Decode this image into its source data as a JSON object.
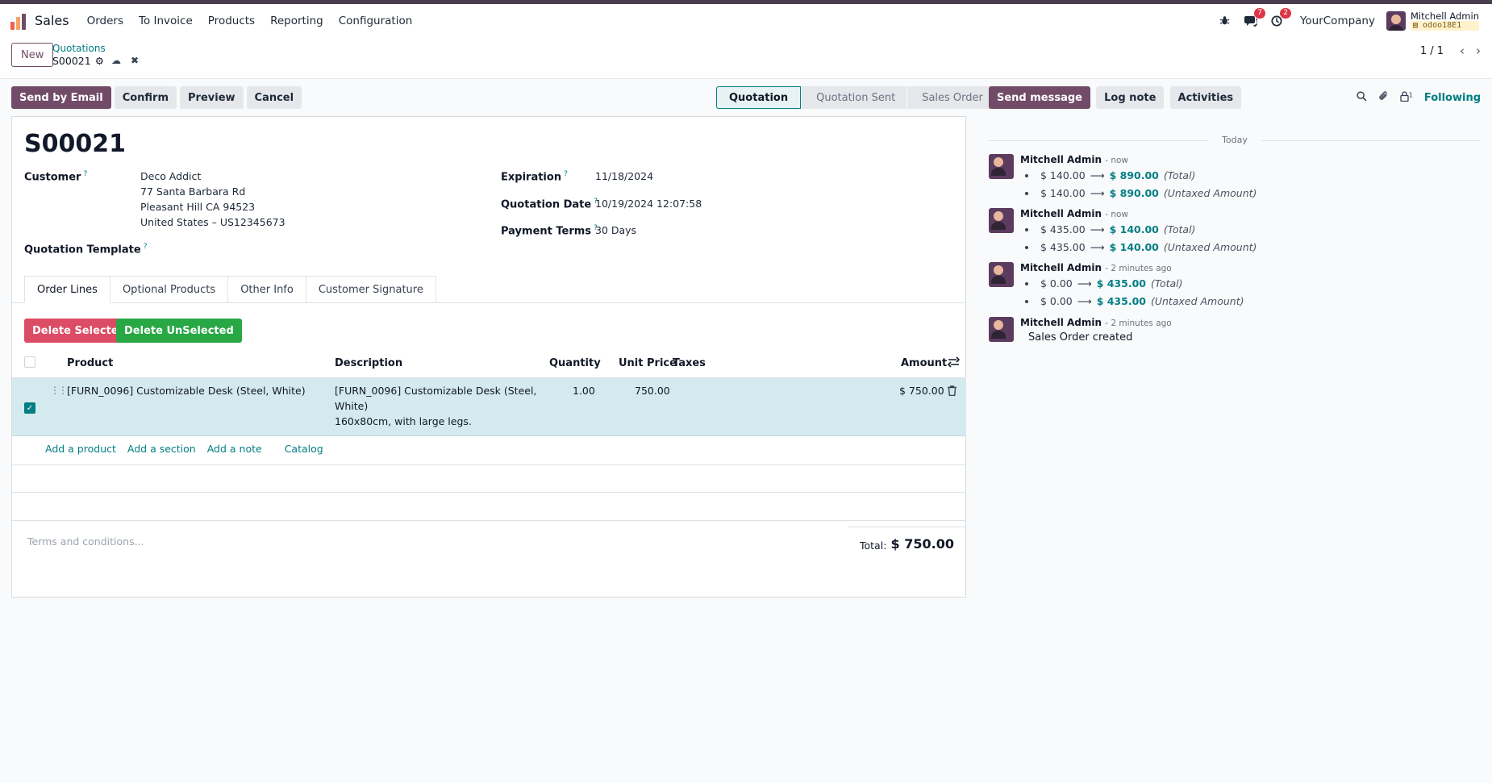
{
  "navbar": {
    "app_name": "Sales",
    "menu": [
      "Orders",
      "To Invoice",
      "Products",
      "Reporting",
      "Configuration"
    ],
    "messages_badge": "7",
    "activities_badge": "2",
    "company": "YourCompany",
    "user_name": "Mitchell Admin",
    "db_name": "odoo18E1"
  },
  "control": {
    "new_label": "New",
    "breadcrumb_parent": "Quotations",
    "breadcrumb_record": "S00021",
    "pager": "1 / 1"
  },
  "actions": {
    "send_email": "Send by Email",
    "confirm": "Confirm",
    "preview": "Preview",
    "cancel": "Cancel"
  },
  "stages": [
    "Quotation",
    "Quotation Sent",
    "Sales Order"
  ],
  "record": {
    "name": "S00021",
    "customer_label": "Customer",
    "customer_name": "Deco Addict",
    "customer_street": "77 Santa Barbara Rd",
    "customer_city": "Pleasant Hill CA 94523",
    "customer_country": "United States – US12345673",
    "template_label": "Quotation Template",
    "expiration_label": "Expiration",
    "expiration": "11/18/2024",
    "quotation_date_label": "Quotation Date",
    "quotation_date": "10/19/2024 12:07:58",
    "payment_terms_label": "Payment Terms",
    "payment_terms": "30 Days",
    "help_mark": "?"
  },
  "tabs": [
    "Order Lines",
    "Optional Products",
    "Other Info",
    "Customer Signature"
  ],
  "order_lines": {
    "delete_selected": "Delete Selected",
    "delete_unselected": "Delete UnSelected",
    "columns": [
      "Product",
      "Description",
      "Quantity",
      "Unit Price",
      "Taxes",
      "Amount"
    ],
    "rows": [
      {
        "product": "[FURN_0096] Customizable Desk (Steel, White)",
        "desc_line1": "[FURN_0096] Customizable Desk (Steel,",
        "desc_line2": "White)",
        "desc_line3": "160x80cm, with large legs.",
        "quantity": "1.00",
        "unit_price": "750.00",
        "taxes": "",
        "amount": "$ 750.00"
      }
    ],
    "add_product": "Add a product",
    "add_section": "Add a section",
    "add_note": "Add a note",
    "catalog": "Catalog",
    "terms_placeholder": "Terms and conditions...",
    "total_label": "Total:",
    "total_value": "$ 750.00"
  },
  "chatter": {
    "send_message": "Send message",
    "log_note": "Log note",
    "activities": "Activities",
    "followers_count": "1",
    "following": "Following",
    "today": "Today",
    "messages": [
      {
        "author": "Mitchell Admin",
        "time": "- now",
        "changes": [
          {
            "old": "$ 140.00",
            "new": "$ 890.00",
            "field": "(Total)"
          },
          {
            "old": "$ 140.00",
            "new": "$ 890.00",
            "field": "(Untaxed Amount)"
          }
        ]
      },
      {
        "author": "Mitchell Admin",
        "time": "- now",
        "changes": [
          {
            "old": "$ 435.00",
            "new": "$ 140.00",
            "field": "(Total)"
          },
          {
            "old": "$ 435.00",
            "new": "$ 140.00",
            "field": "(Untaxed Amount)"
          }
        ]
      },
      {
        "author": "Mitchell Admin",
        "time": "- 2 minutes ago",
        "changes": [
          {
            "old": "$ 0.00",
            "new": "$ 435.00",
            "field": "(Total)"
          },
          {
            "old": "$ 0.00",
            "new": "$ 435.00",
            "field": "(Untaxed Amount)"
          }
        ]
      },
      {
        "author": "Mitchell Admin",
        "time": "- 2 minutes ago",
        "body": "Sales Order created"
      }
    ]
  },
  "colors": {
    "brand": "#714b67",
    "link": "#017e84",
    "danger": "#dc4c64",
    "success": "#28a745",
    "selected_row": "#d4eaee"
  }
}
